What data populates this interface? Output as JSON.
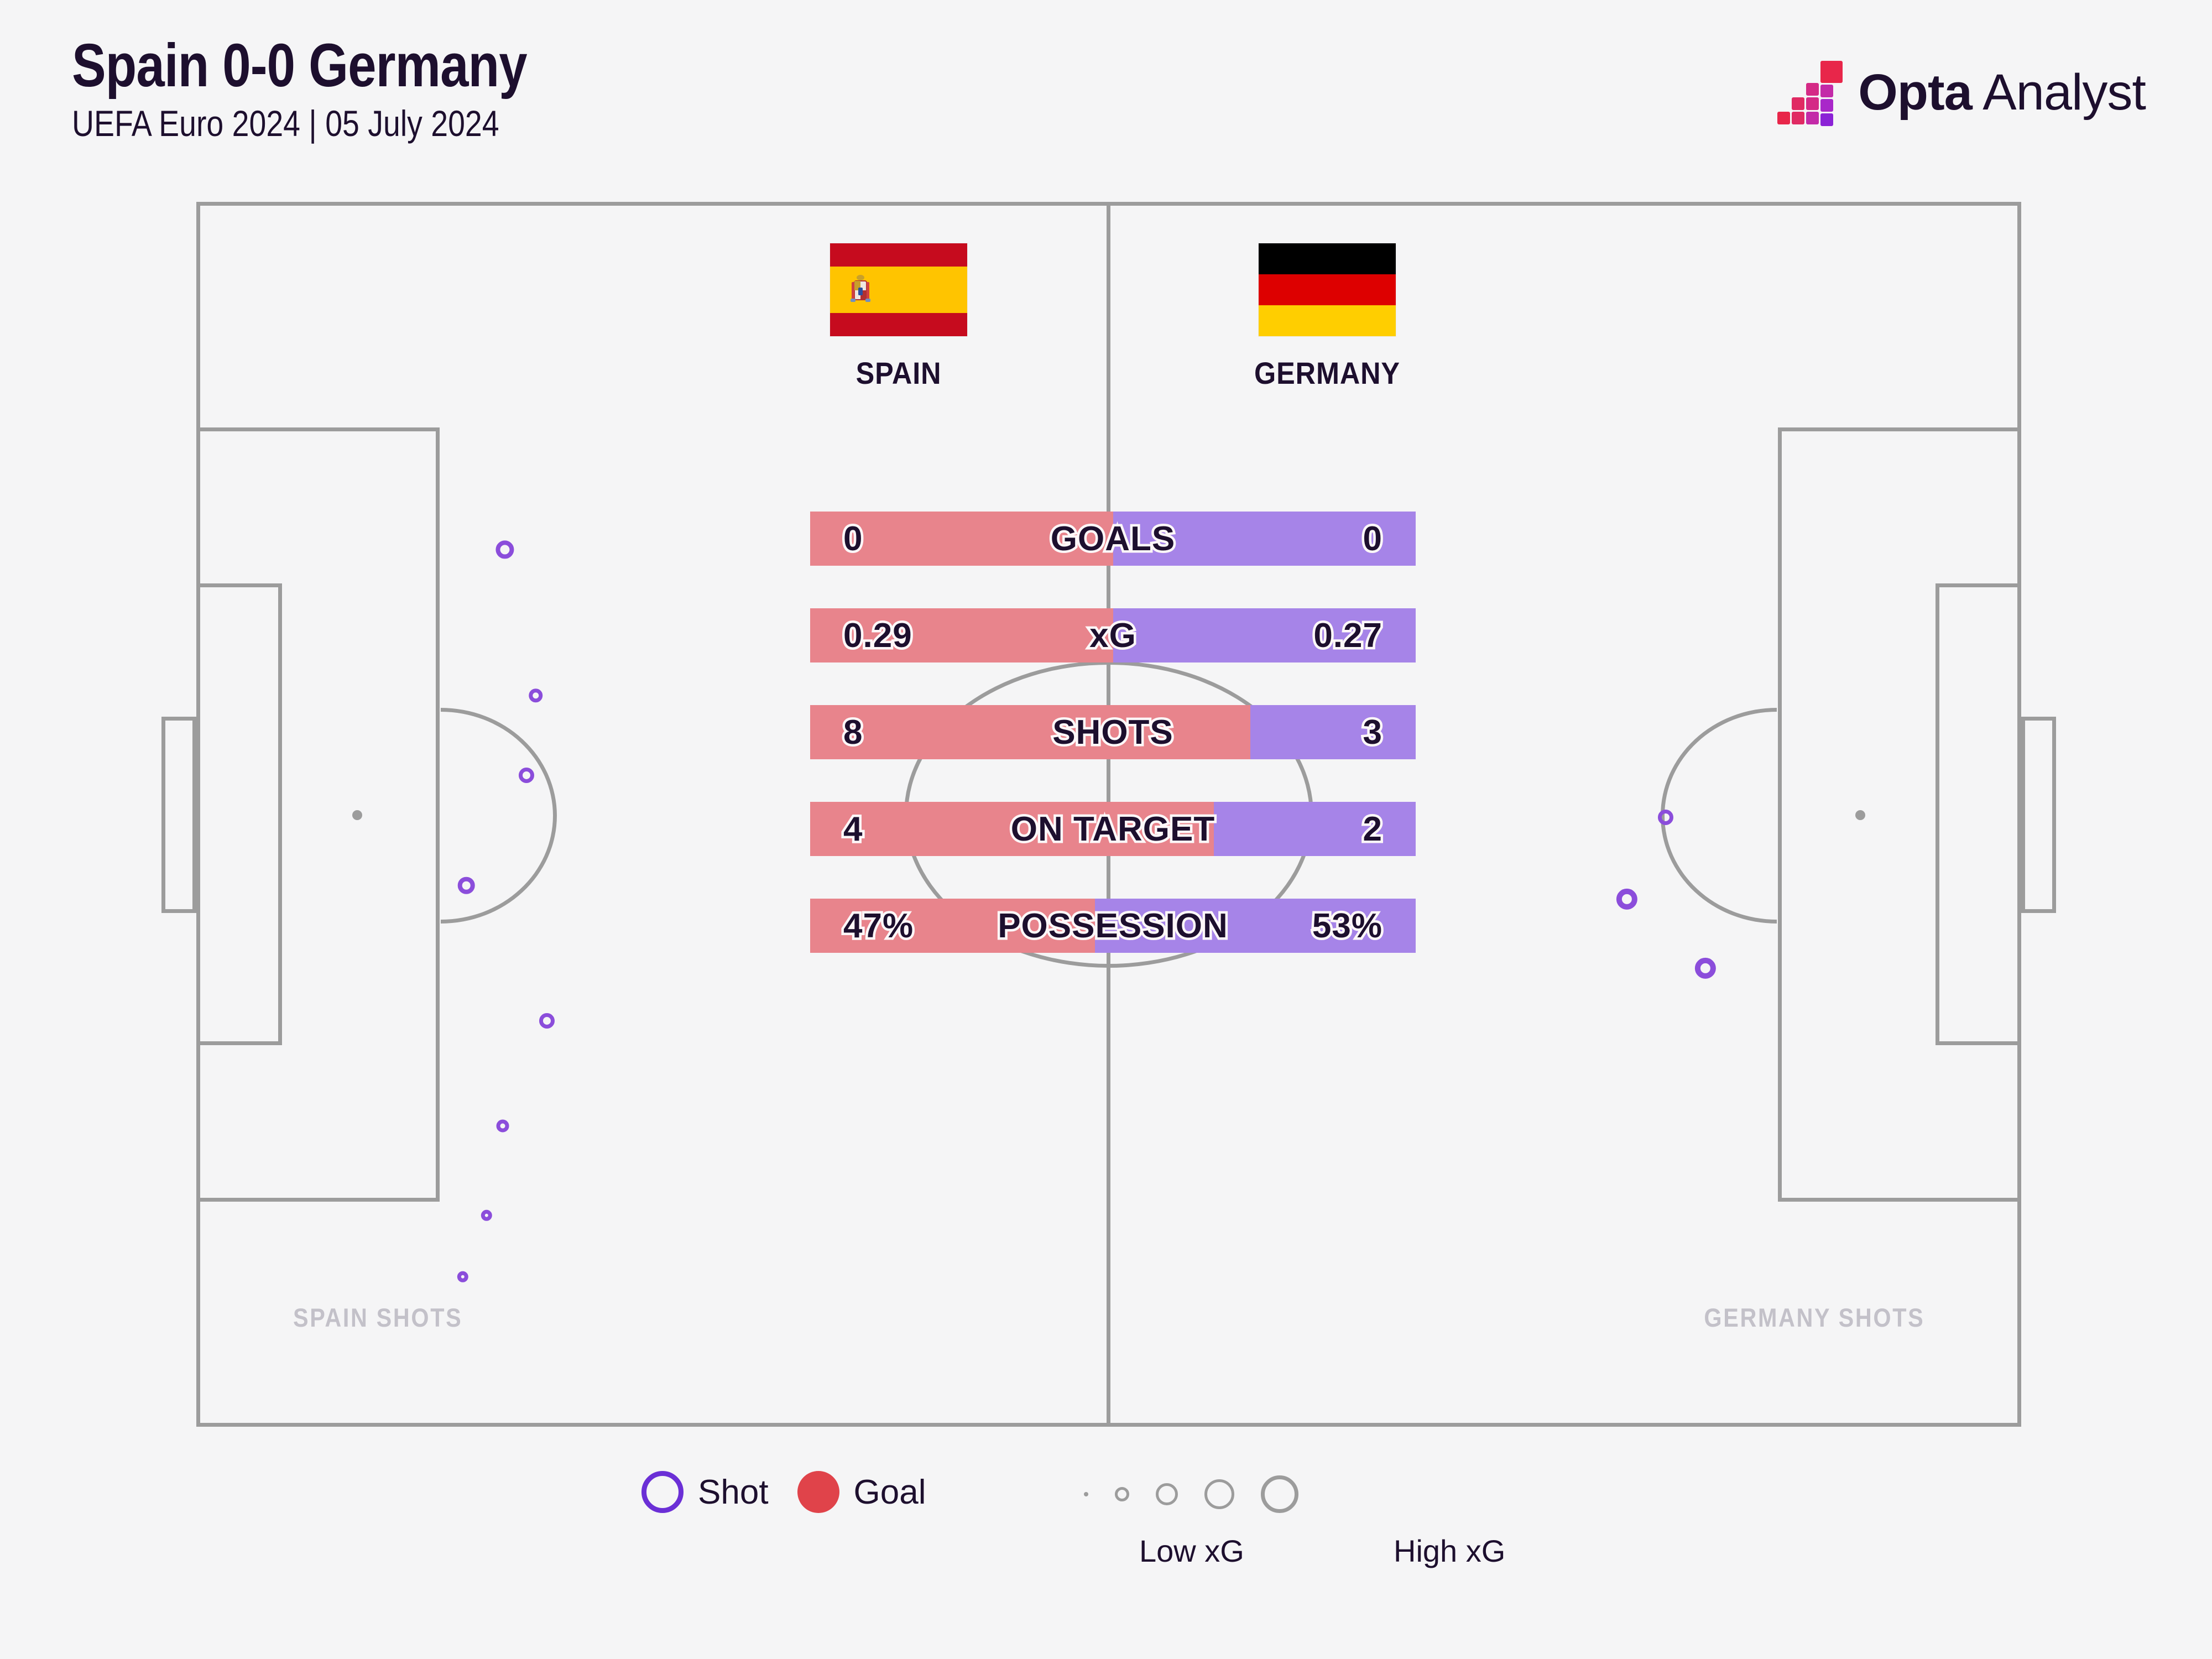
{
  "header": {
    "title": "Spain 0-0 Germany",
    "subtitle": "UEFA Euro 2024 | 05 July 2024"
  },
  "brand": {
    "name_bold": "Opta",
    "name_light": " Analyst",
    "logo_colors": [
      "#e8264a",
      "#e02a63",
      "#d42a86",
      "#c32aa8",
      "#a927c9",
      "#8b22d6"
    ]
  },
  "teams": {
    "home": {
      "name": "SPAIN",
      "flag_icon": "spain-flag",
      "flag_bands": [
        "#c60b1e",
        "#ffc400",
        "#c60b1e"
      ],
      "accent": "#e8848c",
      "pitch_label": "SPAIN SHOTS"
    },
    "away": {
      "name": "GERMANY",
      "flag_icon": "germany-flag",
      "flag_bands": [
        "#000000",
        "#dd0000",
        "#ffce00"
      ],
      "accent": "#a684e8",
      "pitch_label": "GERMANY SHOTS"
    }
  },
  "chart_data": {
    "type": "bar",
    "title": "Spain 0-0 Germany",
    "subtitle": "UEFA Euro 2024 | 05 July 2024",
    "orientation": "horizontal-diverging",
    "categories": [
      "GOALS",
      "xG",
      "SHOTS",
      "ON TARGET",
      "POSSESSION"
    ],
    "series": [
      {
        "name": "SPAIN",
        "values": [
          0,
          0.29,
          8,
          4,
          47
        ],
        "display": [
          "0",
          "0.29",
          "8",
          "4",
          "47%"
        ],
        "color": "#e8848c"
      },
      {
        "name": "GERMANY",
        "values": [
          0,
          0.27,
          3,
          2,
          53
        ],
        "display": [
          "0",
          "0.27",
          "3",
          "2",
          "53%"
        ],
        "color": "#a684e8"
      }
    ],
    "rows": [
      {
        "label": "GOALS",
        "home": "0",
        "away": "0",
        "home_pct": 50.0
      },
      {
        "label": "xG",
        "home": "0.29",
        "away": "0.27",
        "home_pct": 50.0
      },
      {
        "label": "SHOTS",
        "home": "8",
        "away": "3",
        "home_pct": 72.7
      },
      {
        "label": "ON TARGET",
        "home": "4",
        "away": "2",
        "home_pct": 66.7
      },
      {
        "label": "POSSESSION",
        "home": "47%",
        "away": "53%",
        "home_pct": 47.0
      }
    ],
    "shot_map": {
      "home_shots": [
        {
          "x": 16.9,
          "y": 30.3,
          "r": 13
        },
        {
          "x": 18.6,
          "y": 45.3,
          "r": 10
        },
        {
          "x": 18.1,
          "y": 53.5,
          "r": 11
        },
        {
          "x": 14.8,
          "y": 64.8,
          "r": 12
        },
        {
          "x": 19.2,
          "y": 78.7,
          "r": 11
        },
        {
          "x": 16.8,
          "y": 89.5,
          "r": 9
        },
        {
          "x": 15.9,
          "y": 98.7,
          "r": 8
        },
        {
          "x": 14.6,
          "y": 105.0,
          "r": 8
        }
      ],
      "away_shots": [
        {
          "x": 80.5,
          "y": 57.8,
          "r": 11
        },
        {
          "x": 78.4,
          "y": 66.2,
          "r": 15
        },
        {
          "x": 82.7,
          "y": 73.3,
          "r": 15
        }
      ]
    }
  },
  "legend": {
    "shot_label": "Shot",
    "goal_label": "Goal",
    "shot_icon": "shot-ring-icon",
    "goal_icon": "goal-dot-icon",
    "shot_color": "#6b2fd6",
    "goal_color": "#e0434a",
    "scale_low_label": "Low xG",
    "scale_high_label": "High xG",
    "scale_sizes": [
      8,
      26,
      40,
      54,
      68
    ]
  }
}
